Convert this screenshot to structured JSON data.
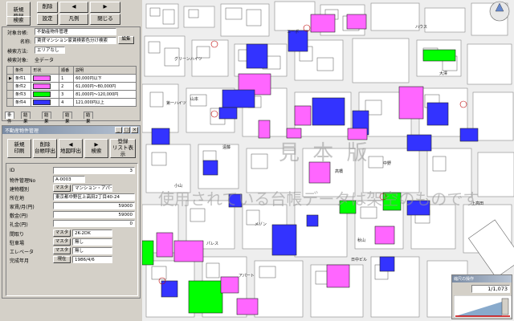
{
  "toolbar": {
    "new_reg": [
      "新規",
      "登録"
    ],
    "delete": "削除",
    "search": "検索",
    "set": "設定",
    "legend": "凡例",
    "close": "閉じる",
    "prev_arrow": "◀",
    "next_arrow": "▶"
  },
  "search_panel": {
    "target_label": "対象台帳:",
    "target_value": "不動産物件管理",
    "name_label": "名称:",
    "name_value": "賃貸マンション家賃検索色分け検索",
    "edit_button": "編集",
    "method_label": "検索方法:",
    "method_value": "エリアなし",
    "target2_label": "検索対象:",
    "target2_value": "全データ",
    "table_headers": [
      "条件",
      "形状",
      "順番",
      "説明"
    ],
    "rows": [
      {
        "name": "条件1",
        "color": "#ff66ff",
        "order": "1",
        "desc": "60,000円以下"
      },
      {
        "name": "条件2",
        "color": "#ff66ff",
        "order": "2",
        "desc": "61,000円～80,000円"
      },
      {
        "name": "条件3",
        "color": "#00ff00",
        "order": "3",
        "desc": "81,000円～120,000円"
      },
      {
        "name": "条件4",
        "color": "#3333ff",
        "order": "4",
        "desc": "121,000円以上"
      }
    ],
    "tabs": [
      "条件",
      "結果1",
      "結果2",
      "結果3",
      "結果4"
    ]
  },
  "ledger": {
    "title": "不動産物件管理",
    "title_controls": [
      "_",
      "□",
      "×"
    ],
    "buttons": [
      {
        "line1": "新規",
        "line2": "印刷"
      },
      {
        "line1": "削除",
        "line2": "台帳呼出"
      },
      {
        "line1": "◀",
        "line2": "地図呼出"
      },
      {
        "line1": "▶",
        "line2": "検索"
      },
      {
        "line1": "登録",
        "line2": "リスト表示"
      }
    ],
    "fields": [
      {
        "label": "ID",
        "value": "3",
        "align": "right",
        "button": ""
      },
      {
        "label": "物件管理No",
        "value": "A-0003",
        "align": "left",
        "button": ""
      },
      {
        "label": "建物種別",
        "value": "マンション・アパート",
        "align": "left",
        "button": "マスタ"
      },
      {
        "label": "所在地",
        "value": "東京都中野区上高田2丁目40-24",
        "align": "left",
        "button": ""
      },
      {
        "label": "家賃/月(円)",
        "value": "59000",
        "align": "right",
        "button": ""
      },
      {
        "label": "敷金(円)",
        "value": "59000",
        "align": "right",
        "button": ""
      },
      {
        "label": "礼金(円)",
        "value": "0",
        "align": "right",
        "button": ""
      },
      {
        "label": "間取り",
        "value": "2K-2DK",
        "align": "left",
        "button": "マスタ"
      },
      {
        "label": "駐車場",
        "value": "無し",
        "align": "left",
        "button": "マスタ"
      },
      {
        "label": "エレベータ",
        "value": "無し",
        "align": "left",
        "button": "マスタ"
      },
      {
        "label": "完成年月",
        "value": "1986/4/6",
        "align": "left",
        "button": "現在"
      }
    ]
  },
  "map": {
    "watermark1": "見 本 版",
    "watermark2": "使用されている台帳データは架空のものです",
    "labels": [
      "遠藤",
      "大澤",
      "高橋",
      "山本",
      "メゾン",
      "中野",
      "小山",
      "秋山",
      "第一ハイツ",
      "コーポ",
      "グリーンハイツ",
      "日中ビル",
      "アパート",
      "ハウス",
      "パレス",
      "上高田"
    ],
    "scale_title": "縮尺の操作",
    "scale_value": "1/1,073"
  }
}
